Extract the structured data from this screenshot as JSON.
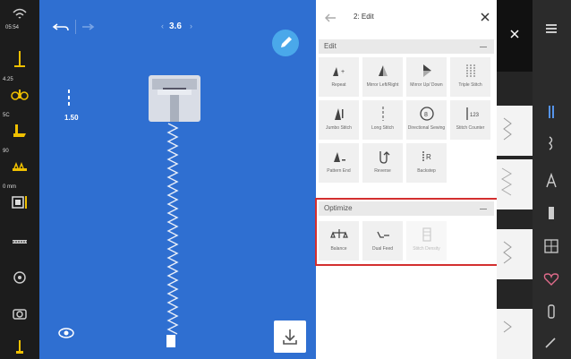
{
  "left_toolbar": {
    "items": [
      {
        "tag": "05:54",
        "icon": "wifi-icon"
      },
      {
        "tag": "",
        "icon": "needle-icon"
      },
      {
        "tag": "4.25",
        "icon": "thread-tension-icon"
      },
      {
        "tag": "5C",
        "icon": "presser-foot-icon"
      },
      {
        "tag": "90",
        "icon": "feed-dog-icon"
      },
      {
        "tag": "0 mm",
        "icon": "bobbin-icon"
      },
      {
        "tag": "",
        "icon": "stitch-plate-icon"
      },
      {
        "tag": "",
        "icon": "needle-position-icon"
      },
      {
        "tag": "",
        "icon": "camera-icon"
      },
      {
        "tag": "",
        "icon": "needle-stop-icon"
      }
    ]
  },
  "canvas": {
    "zoom": "3.6",
    "stitch_width": "1.50",
    "bg_color": "#2f6fd1"
  },
  "panel": {
    "title": "2: Edit",
    "edit_section": {
      "title": "Edit",
      "tiles": [
        {
          "label": "Repeat",
          "icon": "repeat-icon"
        },
        {
          "label": "Mirror Left/Right",
          "icon": "mirror-left-right-icon"
        },
        {
          "label": "Mirror Up/ Down",
          "icon": "mirror-up-down-icon"
        },
        {
          "label": "Triple Stitch",
          "icon": "triple-stitch-icon"
        },
        {
          "label": "Jumbo Stitch",
          "icon": "jumbo-stitch-icon"
        },
        {
          "label": "Long Stitch",
          "icon": "long-stitch-icon"
        },
        {
          "label": "Directional Sewing",
          "icon": "directional-sewing-icon"
        },
        {
          "label": "Stitch Counter",
          "icon": "stitch-counter-icon"
        },
        {
          "label": "Pattern End",
          "icon": "pattern-end-icon"
        },
        {
          "label": "Reverse",
          "icon": "reverse-icon"
        },
        {
          "label": "Backstep",
          "icon": "backstep-icon"
        }
      ]
    },
    "optimize_section": {
      "title": "Optimize",
      "tiles": [
        {
          "label": "Balance",
          "icon": "balance-icon",
          "enabled": true
        },
        {
          "label": "Dual Feed",
          "icon": "dual-feed-icon",
          "enabled": true
        },
        {
          "label": "Stitch Density",
          "icon": "stitch-density-icon",
          "enabled": false
        }
      ]
    }
  },
  "right_nav": {
    "icons": [
      "menu-icon",
      "straight-stitch-icon",
      "decorative-stitch-icon",
      "alphabet-icon",
      "buttonhole-icon",
      "quilt-stitch-icon",
      "heart-icon",
      "bobbin-thread-icon",
      "tools-icon"
    ]
  }
}
